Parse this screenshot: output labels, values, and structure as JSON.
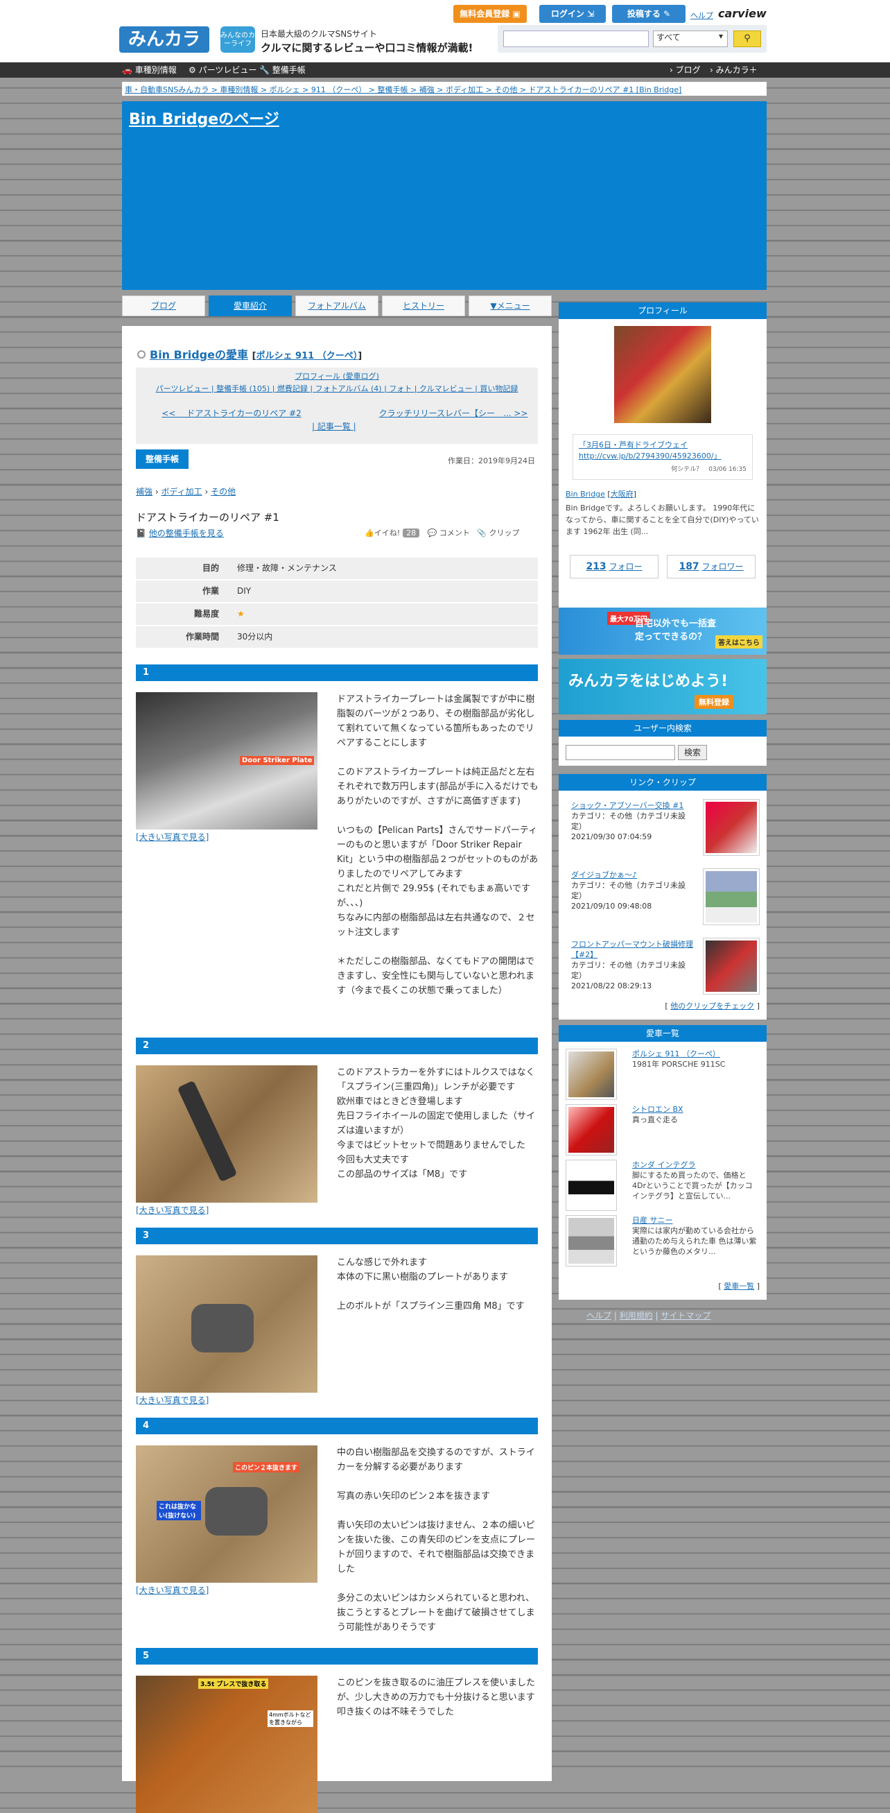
{
  "header": {
    "logo": "みんカラ",
    "badge": "みんなのカーライフ",
    "tagline1": "日本最大級のクルマSNSサイト",
    "tagline2": "クルマに関するレビューや口コミ情報が満載!",
    "btn_register": "無料会員登録",
    "btn_login": "ログイン",
    "btn_post": "投稿する",
    "help": "ヘルプ",
    "carview": "carview",
    "search_select": "すべて"
  },
  "gnav": {
    "items": [
      "車種別情報",
      "パーツレビュー",
      "整備手帳"
    ],
    "right": [
      "ブログ",
      "みんカラ＋"
    ]
  },
  "breadcrumb": "車・自動車SNSみんカラ > 車種別情報 > ポルシェ > 911 （クーペ） > 整備手帳 > 補強 > ボディ加工 > その他 > ドアストライカーのリペア #1 [Bin Bridge]",
  "banner": {
    "title": "Bin Bridgeのページ"
  },
  "tabs": [
    "ブログ",
    "愛車紹介",
    "フォトアルバム",
    "ヒストリー",
    "▼メニュー"
  ],
  "owner": {
    "name": "Bin Bridgeの愛車",
    "car": "ポルシェ 911 （クーペ）"
  },
  "mnav": {
    "line1": "プロフィール (愛車ログ)",
    "line2": "パーツレビュー | 整備手帳 (105) | 燃費記録 | フォトアルバム (4) | フォト | クルマレビュー | 買い物記録"
  },
  "prev": "<<　 ドアストライカーのリペア #2",
  "index": "| 記事一覧 |",
  "next": "クラッチリリースレバー【シー　... >>",
  "category_badge": "整備手帳",
  "work_date": "作業日：2019年9月24日",
  "category_path": [
    "補強",
    "ボディ加工",
    "その他"
  ],
  "article_title": "ドアストライカーのリペア #1",
  "see_all": "他の整備手帳を見る",
  "like": {
    "label": "イイね!",
    "count": "28",
    "comment": "コメント",
    "clip": "クリップ"
  },
  "spec": [
    {
      "k": "目的",
      "v": "修理・故障・メンテナンス"
    },
    {
      "k": "作業",
      "v": "DIY"
    },
    {
      "k": "難易度",
      "v": "★"
    },
    {
      "k": "作業時間",
      "v": "30分以内"
    }
  ],
  "photo_link": "[大きい写真で見る]",
  "steps": [
    {
      "n": "1",
      "photo_label": "Door Striker Plate",
      "text": "ドアストライカープレートは金属製ですが中に樹脂製のパーツが２つあり、その樹脂部品が劣化して割れていて無くなっている箇所もあったのでリペアすることにします\n\nこのドアストライカープレートは純正品だと左右それぞれで数万円します(部品が手に入るだけでもありがたいのですが、さすがに高価すぎます)\n\nいつもの【Pelican Parts】さんでサードパーティーのものと思いますが「Door Striker Repair Kit」という中の樹脂部品２つがセットのものがありましたのでリペアしてみます\nこれだと片側で 29.95$ (それでもまぁ高いですが、、、)\nちなみに内部の樹脂部品は左右共通なので、２セット注文します\n\n＊ただしこの樹脂部品、なくてもドアの開閉はできますし、安全性にも関与していないと思われます（今まで長くこの状態で乗ってました）"
    },
    {
      "n": "2",
      "photo_label": "",
      "text": "このドアストラカーを外すにはトルクスではなく「スプライン(三重四角)」レンチが必要です\n欧州車ではときどき登場します\n先日フライホイールの固定で使用しました（サイズは違いますが）\n今まではビットセットで問題ありませんでした　今回も大丈夫です\nこの部品のサイズは「M8」です"
    },
    {
      "n": "3",
      "photo_label": "",
      "text": "こんな感じで外れます\n本体の下に黒い樹脂のプレートがあります\n\n上のボルトが「スプライン三重四角 M8」です"
    },
    {
      "n": "4",
      "photo_label": "このピン２本抜きます",
      "photo_label2": "これは抜かない(抜けない)",
      "text": "中の白い樹脂部品を交換するのですが、ストライカーを分解する必要があります\n\n写真の赤い矢印のピン２本を抜きます\n\n青い矢印の太いピンは抜けません、２本の細いピンを抜いた後、この青矢印のピンを支点にプレートが回りますので、それで樹脂部品は交換できました\n\n多分この太いピンはカシメられていると思われ、抜こうとするとプレートを曲げて破損させてしまう可能性がありそうです"
    },
    {
      "n": "5",
      "photo_label": "3.5t プレスで抜き取る",
      "photo_label2": "4mmボルトなどを置きながら",
      "text": "このピンを抜き取るのに油圧プレスを使いましたが、少し大きめの万力でも十分抜けると思います\n叩き抜くのは不味そうでした"
    }
  ],
  "profile": {
    "heading": "プロフィール",
    "feed": "「3月6日・芦有ドライブウェイ http://cvw.jp/b/2794390/45923600/」",
    "feed_meta": "何シテル？　03/06 16:35",
    "name": "Bin Bridge",
    "location": "大阪府",
    "desc": "Bin Bridgeです。よろしくお願いします。 1990年代になってから、車に関することを全て自分で(DIY)やっています 1962年 出生 (同...",
    "follow": "213",
    "follow_label": "フォロー",
    "follower": "187",
    "follower_label": "フォロワー"
  },
  "ads": [
    {
      "main": "自宅以外でも一括査定ってできるの？",
      "sub": "答えはこちら",
      "tag": "最大70万円"
    },
    {
      "main": "みんカラをはじめよう!",
      "sub": "無料登録"
    }
  ],
  "user_search": {
    "heading": "ユーザー内検索",
    "button": "検索"
  },
  "clips": {
    "heading": "リンク・クリップ",
    "items": [
      {
        "title": "ショック・アブソーバー交換 #1",
        "cat": "カテゴリ：その他（カテゴリ未設定）",
        "date": "2021/09/30 07:04:59"
      },
      {
        "title": "ダイジョブかぁ～♪",
        "cat": "カテゴリ：その他（カテゴリ未設定）",
        "date": "2021/09/10 09:48:08"
      },
      {
        "title": "フロントアッパーマウント破損修理【#2】",
        "cat": "カテゴリ：その他（カテゴリ未設定）",
        "date": "2021/08/22 08:29:13"
      }
    ],
    "more": "他のクリップをチェック"
  },
  "cars": {
    "heading": "愛車一覧",
    "items": [
      {
        "name": "ポルシェ 911 （クーペ）",
        "desc": "1981年 PORSCHE 911SC"
      },
      {
        "name": "シトロエン BX",
        "desc": "真っ直ぐ走る"
      },
      {
        "name": "ホンダ インテグラ",
        "desc": "脚にするため買ったので、価格と4Drということで買ったが【カッコインテグラ】と宣伝してい..."
      },
      {
        "name": "日産 サニー",
        "desc": "実際には家内が勤めている会社から通勤のため与えられた車 色は薄い紫というか藤色のメタリ..."
      }
    ],
    "more": "愛車一覧"
  },
  "footer": [
    "ヘルプ",
    "利用規約",
    "サイトマップ"
  ]
}
